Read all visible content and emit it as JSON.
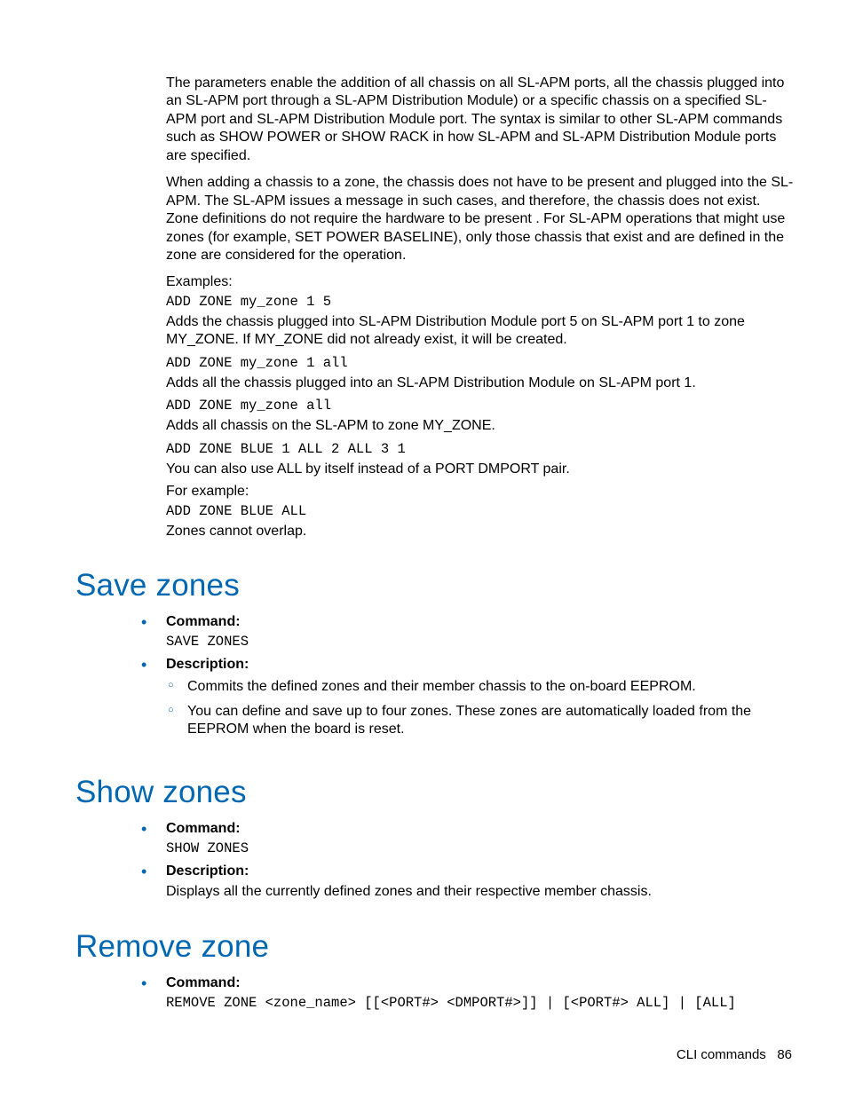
{
  "intro": {
    "para1": "The parameters enable the addition of all chassis on all SL-APM ports, all the chassis plugged into an SL-APM port through a SL-APM Distribution Module) or a specific chassis on a specified SL-APM port and SL-APM Distribution Module port. The syntax is similar to other SL-APM commands such as SHOW POWER or SHOW RACK in how SL-APM and SL-APM Distribution Module ports are specified.",
    "para2": "When adding a chassis to a zone, the chassis does not have to be present and plugged into the SL-APM. The SL-APM issues a message in such cases, and therefore, the chassis does not exist. Zone definitions do not require the hardware to be present . For SL-APM operations that might use zones (for example, SET POWER BASELINE), only those chassis that exist and are defined in the zone are considered for the operation.",
    "examples_label": "Examples:",
    "ex1_code": "ADD ZONE my_zone 1 5",
    "ex1_desc": "Adds the chassis plugged into SL-APM Distribution Module port 5 on SL-APM port 1 to zone MY_ZONE. If MY_ZONE did not already exist, it will be created.",
    "ex2_code": "ADD ZONE my_zone 1 all",
    "ex2_desc": "Adds all the chassis plugged into an SL-APM Distribution Module on SL-APM port 1.",
    "ex3_code": "ADD ZONE my_zone all",
    "ex3_desc": "Adds all chassis on the SL-APM to zone MY_ZONE.",
    "ex4_code": "ADD ZONE BLUE 1 ALL 2 ALL 3 1",
    "ex4_desc": "You can also use ALL by itself instead of a PORT DMPORT pair.",
    "for_example": "For example:",
    "ex5_code": "ADD ZONE BLUE ALL",
    "ex5_desc": "Zones cannot overlap."
  },
  "save_zones": {
    "heading": "Save zones",
    "command_label": "Command:",
    "command_code": "SAVE ZONES",
    "description_label": "Description:",
    "desc_items": [
      "Commits the defined zones and their member chassis to the on-board EEPROM.",
      "You can define and save up to four zones. These zones are automatically loaded from the EEPROM when the board is reset."
    ]
  },
  "show_zones": {
    "heading": "Show zones",
    "command_label": "Command:",
    "command_code": "SHOW ZONES",
    "description_label": "Description:",
    "description_body": "Displays all the currently defined zones and their respective member chassis."
  },
  "remove_zone": {
    "heading": "Remove zone",
    "command_label": "Command:",
    "command_code": "REMOVE ZONE <zone_name> [[<PORT#> <DMPORT#>]] | [<PORT#> ALL] | [ALL]"
  },
  "footer": {
    "section": "CLI commands",
    "page": "86"
  }
}
